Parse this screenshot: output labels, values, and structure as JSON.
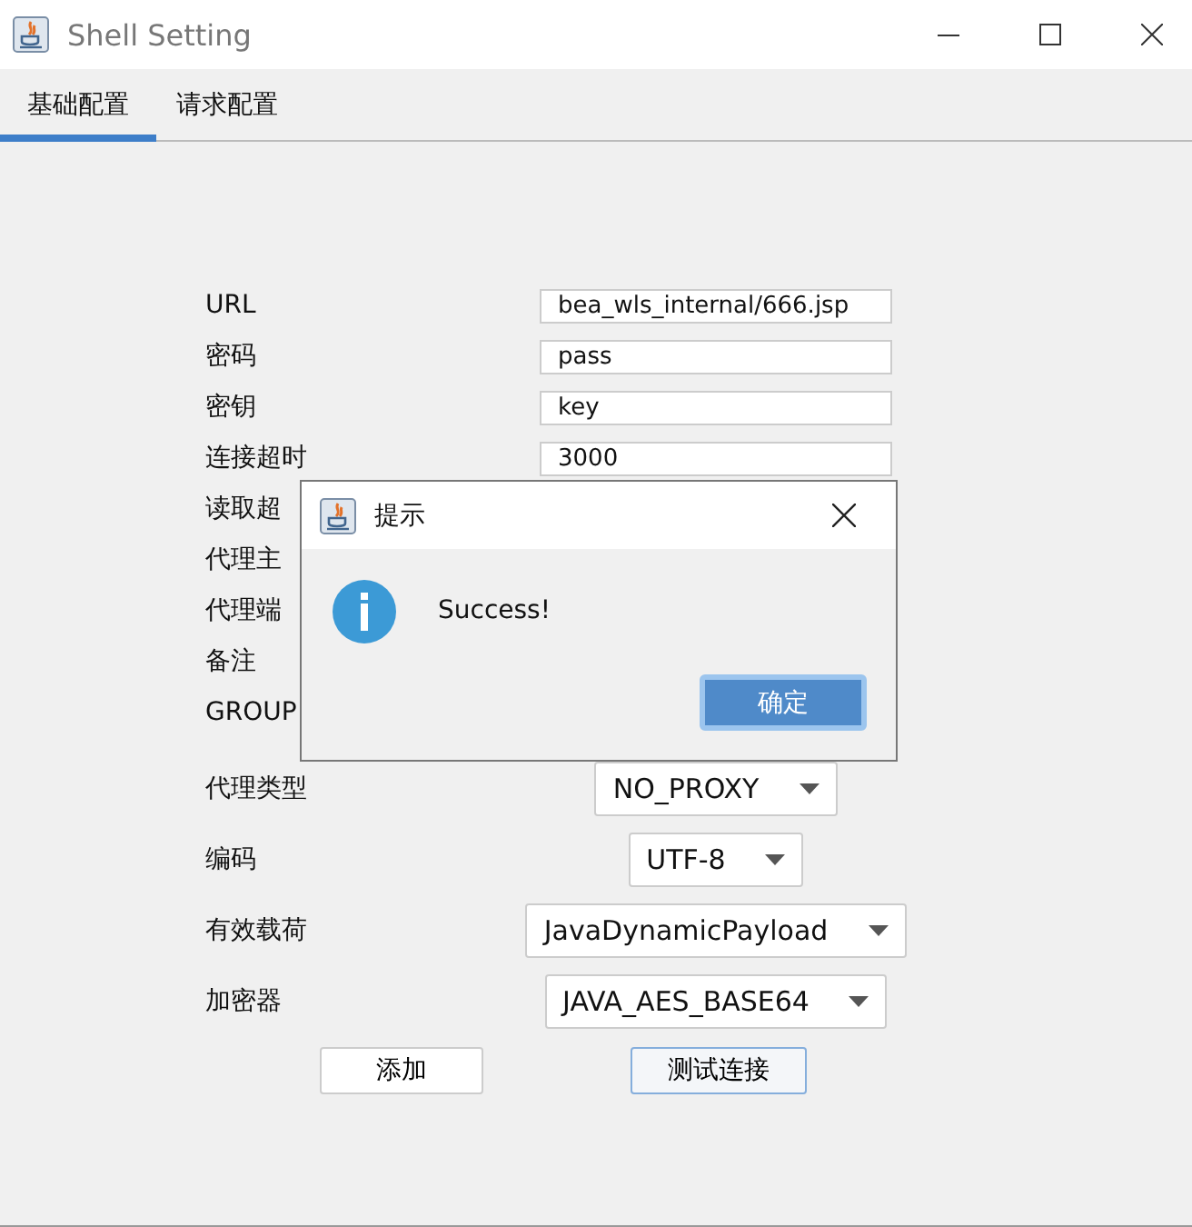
{
  "window": {
    "title": "Shell Setting"
  },
  "tabs": [
    {
      "label": "基础配置",
      "selected": true
    },
    {
      "label": "请求配置",
      "selected": false
    }
  ],
  "form": [
    {
      "kind": "text",
      "label": "URL",
      "value": "bea_wls_internal/666.jsp"
    },
    {
      "kind": "text",
      "label": "密码",
      "value": "pass"
    },
    {
      "kind": "text",
      "label": "密钥",
      "value": "key"
    },
    {
      "kind": "text",
      "label": "连接超时",
      "value": "3000"
    },
    {
      "kind": "label",
      "label": "读取超"
    },
    {
      "kind": "label",
      "label": "代理主"
    },
    {
      "kind": "label",
      "label": "代理端"
    },
    {
      "kind": "label",
      "label": "备注"
    },
    {
      "kind": "label",
      "label": "GROUP"
    },
    {
      "kind": "combo",
      "label": "代理类型",
      "value": "NO_PROXY"
    },
    {
      "kind": "combo",
      "label": "编码",
      "value": "UTF-8"
    },
    {
      "kind": "combo",
      "label": "有效载荷",
      "value": "JavaDynamicPayload"
    },
    {
      "kind": "combo",
      "label": "加密器",
      "value": "JAVA_AES_BASE64"
    }
  ],
  "buttons": [
    {
      "label": "添加",
      "selected": false
    },
    {
      "label": "测试连接",
      "selected": true
    }
  ],
  "dialog": {
    "title": "提示",
    "message": "Success!",
    "button": "确定"
  }
}
